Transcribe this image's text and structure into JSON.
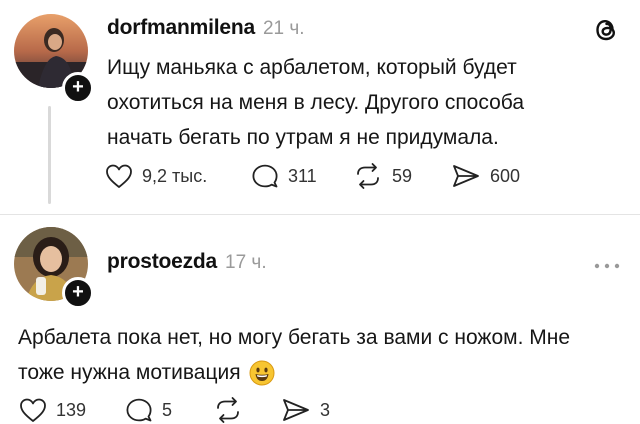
{
  "post1": {
    "username": "dorfmanmilena",
    "time": "21 ч.",
    "text_lines": [
      "Ищу маньяка с арбалетом, который будет",
      "охотиться на меня в лесу. Другого способа",
      "начать бегать по утрам я не придумала."
    ],
    "likes": "9,2 тыс.",
    "comments": "311",
    "reposts": "59",
    "shares": "600"
  },
  "post2": {
    "username": "prostoezda",
    "time": "17 ч.",
    "text_lines": [
      "Арбалета пока нет, но могу бегать за вами с ножом. Мне",
      "тоже нужна мотивация"
    ],
    "emoji": "😃",
    "likes": "139",
    "comments": "5",
    "reposts": "",
    "shares": "3"
  },
  "icons": {
    "logo": "threads-logo-icon",
    "more": "more-options-icon",
    "like": "heart-icon",
    "comment": "comment-bubble-icon",
    "repost": "repost-icon",
    "share": "send-icon"
  }
}
